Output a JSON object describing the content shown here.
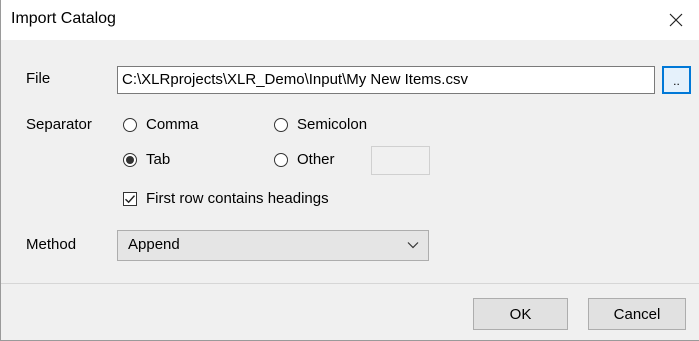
{
  "window": {
    "title": "Import Catalog"
  },
  "file": {
    "label": "File",
    "value": "C:\\XLRprojects\\XLR_Demo\\Input\\My New Items.csv",
    "browse_label": ".."
  },
  "separator": {
    "label": "Separator",
    "options": [
      {
        "label": "Comma",
        "checked": false
      },
      {
        "label": "Semicolon",
        "checked": false
      },
      {
        "label": "Tab",
        "checked": true
      },
      {
        "label": "Other",
        "checked": false
      }
    ],
    "other_value": ""
  },
  "headings": {
    "label": "First row contains headings",
    "checked": true
  },
  "method": {
    "label": "Method",
    "selected": "Append"
  },
  "buttons": {
    "ok": "OK",
    "cancel": "Cancel"
  },
  "colors": {
    "accent": "#0078d7",
    "dialog_bg": "#f0f0f0"
  }
}
